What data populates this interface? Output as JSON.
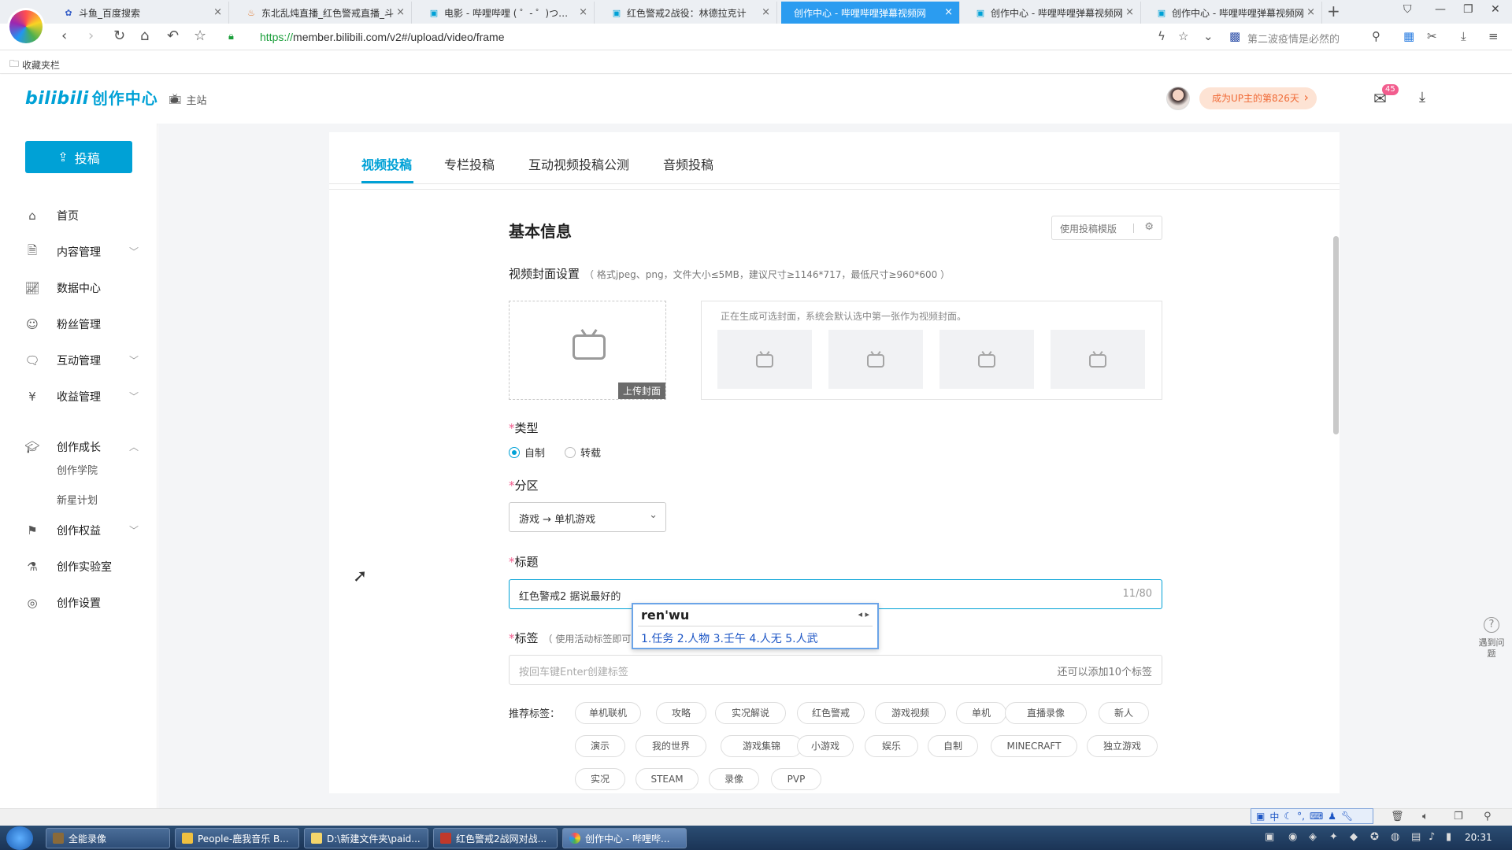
{
  "browser": {
    "tabs": [
      {
        "title": "斗鱼_百度搜索",
        "icon": "paw-icon",
        "active": false
      },
      {
        "title": "东北乱炖直播_红色警戒直播_斗",
        "icon": "flame-icon",
        "active": false
      },
      {
        "title": "电影 - 哔哩哔哩 ( ゜- ゜)つロ 干",
        "icon": "bilibili-tv-icon",
        "active": false
      },
      {
        "title": "红色警戒2战役：林德拉克计",
        "icon": "bilibili-tv-icon",
        "active": false
      },
      {
        "title": "创作中心 - 哔哩哔哩弹幕视频网",
        "icon": "",
        "active": true
      },
      {
        "title": "创作中心 - 哔哩哔哩弹幕视频网",
        "icon": "bilibili-tv-icon",
        "active": false
      },
      {
        "title": "创作中心 - 哔哩哔哩弹幕视频网",
        "icon": "bilibili-tv-icon",
        "active": false
      }
    ],
    "url_scheme": "https://",
    "url_rest": "member.bilibili.com/v2#/upload/video/frame",
    "search_hint": "第二波疫情是必然的",
    "bookmark_folder": "收藏夹栏"
  },
  "header": {
    "brand": "bilibili",
    "brand_sub": "创作中心",
    "home_link": "主站",
    "up_badge": "成为UP主的第826天",
    "mail_count": "45"
  },
  "sidebar": {
    "upload_button": "投稿",
    "items": [
      {
        "label": "首页",
        "icon": "home-icon",
        "chevron": ""
      },
      {
        "label": "内容管理",
        "icon": "document-icon",
        "chevron": "﹀"
      },
      {
        "label": "数据中心",
        "icon": "chart-icon",
        "chevron": ""
      },
      {
        "label": "粉丝管理",
        "icon": "user-icon",
        "chevron": ""
      },
      {
        "label": "互动管理",
        "icon": "chat-icon",
        "chevron": "﹀"
      },
      {
        "label": "收益管理",
        "icon": "money-icon",
        "chevron": "﹀"
      },
      {
        "label": "创作成长",
        "icon": "graduation-icon",
        "chevron": "︿"
      },
      {
        "label": "创作权益",
        "icon": "flag-icon",
        "chevron": "﹀"
      },
      {
        "label": "创作实验室",
        "icon": "flask-icon",
        "chevron": ""
      },
      {
        "label": "创作设置",
        "icon": "settings-icon",
        "chevron": ""
      }
    ],
    "sub_items": [
      "创作学院",
      "新星计划"
    ]
  },
  "upload_tabs": [
    "视频投稿",
    "专栏投稿",
    "互动视频投稿公测",
    "音频投稿"
  ],
  "form": {
    "section_title": "基本信息",
    "template_button": "使用投稿模版",
    "cover_label": "视频封面设置",
    "cover_hint": "（ 格式jpeg、png，文件大小≤5MB，建议尺寸≥1146*717，最低尺寸≥960*600 ）",
    "cover_upload_label": "上传封面",
    "cover_gen_tip": "正在生成可选封面，系统会默认选中第一张作为视频封面。",
    "type_label": "类型",
    "type_options": [
      "自制",
      "转载"
    ],
    "type_selected": "自制",
    "category_label": "分区",
    "category_value": "游戏 → 单机游戏",
    "title_label": "标题",
    "title_value": "红色警戒2 据说最好的",
    "title_count": "11/80",
    "tags_label": "标签",
    "tags_hint": "（ 使用活动标签即可",
    "tags_placeholder": "按回车键Enter创建标签",
    "tags_remaining": "还可以添加10个标签",
    "recommend_label": "推荐标签：",
    "recommended_tags": [
      "单机联机",
      "攻略",
      "实况解说",
      "红色警戒",
      "游戏视频",
      "单机",
      "直播录像",
      "新人",
      "演示",
      "我的世界",
      "游戏集锦",
      "小游戏",
      "娱乐",
      "自制",
      "MINECRAFT",
      "独立游戏",
      "实况",
      "STEAM",
      "录像",
      "PVP"
    ]
  },
  "ime": {
    "pinyin": "ren'wu",
    "candidates": "1.任务  2.人物  3.壬午  4.人无  5.人武",
    "bar_label": "中"
  },
  "help": {
    "label": "遇到问题"
  },
  "taskbar": {
    "items": [
      {
        "label": "全能录像",
        "active": false
      },
      {
        "label": "People-鹿我音乐 B...",
        "active": false
      },
      {
        "label": "D:\\新建文件夹\\paid...",
        "active": false
      },
      {
        "label": "红色警戒2战网对战...",
        "active": false
      },
      {
        "label": "创作中心 - 哔哩哔...",
        "active": true
      }
    ],
    "clock": "20:31"
  }
}
